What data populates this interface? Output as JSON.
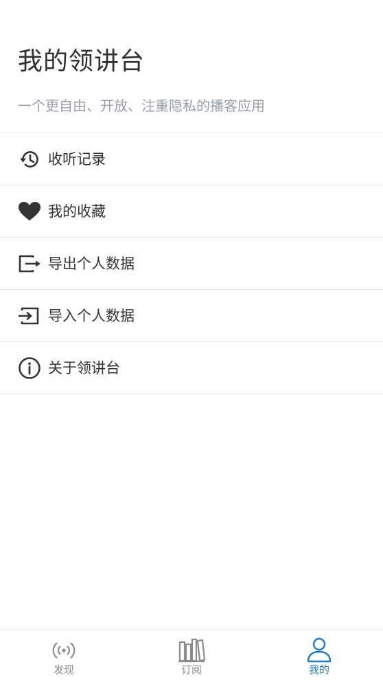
{
  "header": {
    "title": "我的领讲台",
    "subtitle": "一个更自由、开放、注重隐私的播客应用"
  },
  "menu": {
    "items": [
      {
        "label": "收听记录",
        "icon": "history-icon"
      },
      {
        "label": "我的收藏",
        "icon": "heart-icon"
      },
      {
        "label": "导出个人数据",
        "icon": "export-icon"
      },
      {
        "label": "导入个人数据",
        "icon": "import-icon"
      },
      {
        "label": "关于领讲台",
        "icon": "info-icon"
      }
    ]
  },
  "tabbar": {
    "tabs": [
      {
        "label": "发现",
        "icon": "broadcast-icon",
        "active": false
      },
      {
        "label": "订阅",
        "icon": "library-icon",
        "active": false
      },
      {
        "label": "我的",
        "icon": "user-icon",
        "active": true
      }
    ],
    "active_color": "#1f78d1",
    "inactive_color": "#8c8c8c"
  }
}
